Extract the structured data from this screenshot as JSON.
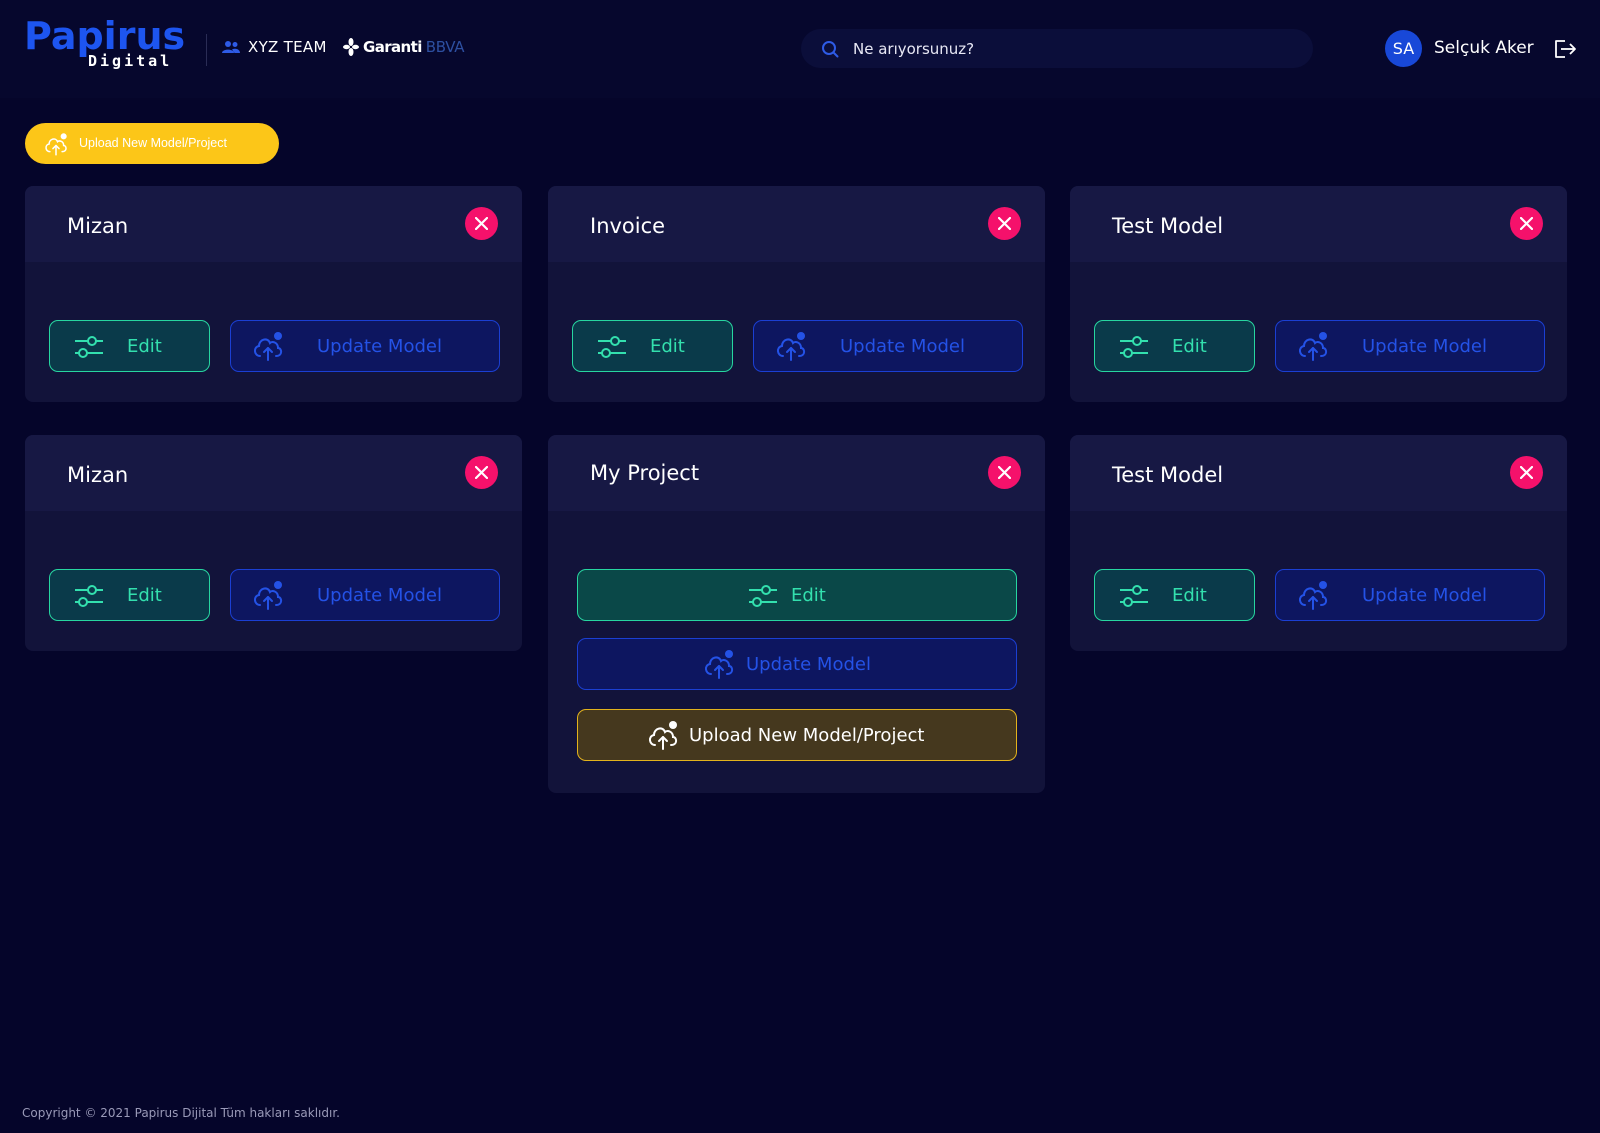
{
  "header": {
    "logo": {
      "main": "Papirus",
      "sub": "Digital"
    },
    "team": {
      "label": "XYZ TEAM"
    },
    "partner": {
      "name": "Garanti",
      "brand": "BBVA"
    },
    "search": {
      "placeholder": "Ne arıyorsunuz?"
    },
    "user": {
      "initials": "SA",
      "name": "Selçuk Aker"
    }
  },
  "toolbar": {
    "upload_label": "Upload New Model/Project"
  },
  "cards": [
    {
      "title": "Mizan",
      "edit_label": "Edit",
      "update_label": "Update Model"
    },
    {
      "title": "Invoice",
      "edit_label": "Edit",
      "update_label": "Update Model"
    },
    {
      "title": "Test Model",
      "edit_label": "Edit",
      "update_label": "Update Model"
    },
    {
      "title": "Mizan",
      "edit_label": "Edit",
      "update_label": "Update Model"
    },
    {
      "title": "My Project",
      "edit_label": "Edit",
      "update_label": "Update Model",
      "upload_label": "Upload New Model/Project"
    },
    {
      "title": "Test Model",
      "edit_label": "Edit",
      "update_label": "Update Model"
    }
  ],
  "footer": {
    "copyright": "Copyright © 2021 Papirus Dijital Tüm hakları saklıdır."
  },
  "colors": {
    "background": "#05052a",
    "card": "#12133a",
    "accent_blue": "#1d55f0",
    "accent_green": "#27d6a0",
    "accent_yellow": "#fcc618",
    "close_pink": "#f5116b"
  }
}
